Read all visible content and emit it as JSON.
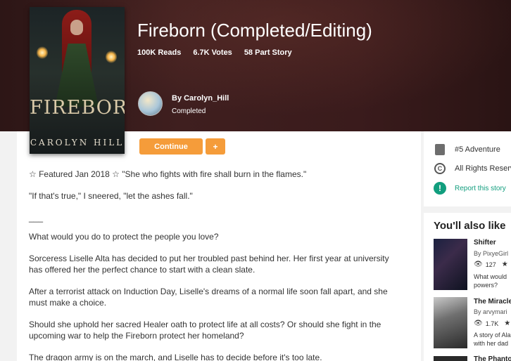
{
  "story": {
    "title": "Fireborn (Completed/Editing)",
    "stats": {
      "reads": "100K Reads",
      "votes": "6.7K Votes",
      "parts": "58 Part Story"
    },
    "author": {
      "by": "By Carolyn_Hill",
      "status": "Completed"
    },
    "cover": {
      "title": "FIREBORN",
      "author": "CAROLYN HILL"
    }
  },
  "actions": {
    "continue": "Continue",
    "add": "+"
  },
  "description": [
    "☆ Featured Jan 2018 ☆ \"She who fights with fire shall burn in the flames.\"",
    "\"If that's true,\" I sneered, \"let the ashes fall.\"",
    "___",
    "What would you do to protect the people you love?",
    "Sorceress Liselle Alta has decided to put her troubled past behind her. Her first year at university has offered her the perfect chance to start with a clean slate.",
    "After a terrorist attack on Induction Day, Liselle's dreams of a normal life soon fall apart, and she must make a choice.",
    "Should she uphold her sacred Healer oath to protect life at all costs? Or should she fight in the upcoming war to help the Fireborn protect her homeland?",
    "The dragon army is on the march, and Liselle has to decide before it's too late."
  ],
  "sidebar": {
    "rank": "#5 Adventure",
    "rights": "All Rights Reserved",
    "report": "Report this story",
    "also_like_title": "You'll also like",
    "recommendations": [
      {
        "title": "Shifter",
        "author": "By PixyeGirl",
        "reads": "127",
        "desc_1": "What would",
        "desc_2": "powers?"
      },
      {
        "title": "The Miracle",
        "author": "By arvymari",
        "reads": "1.7K",
        "desc_1": "A story of Ala",
        "desc_2": "with her dad"
      },
      {
        "title": "The Phantom"
      }
    ]
  },
  "colors": {
    "accent_orange": "#f59c3a",
    "report_green": "#119e7e",
    "hero_bg": "#3a1b1c"
  }
}
